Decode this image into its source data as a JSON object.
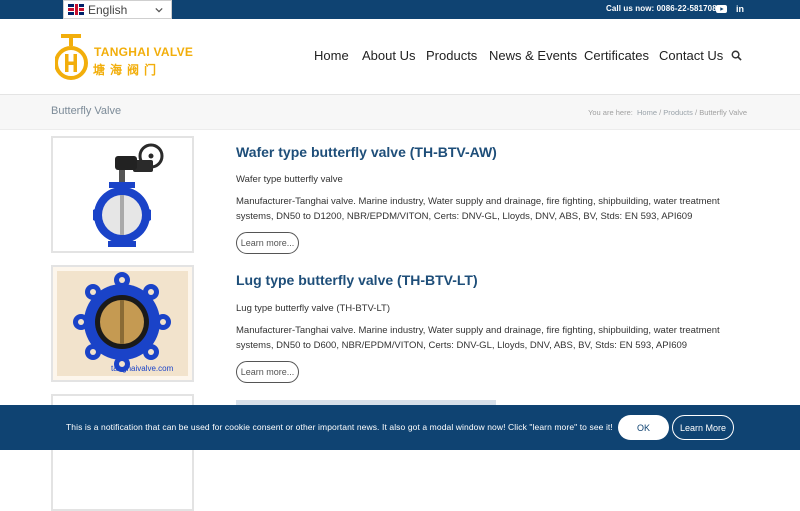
{
  "topbar": {
    "language": "English",
    "call_text": "Call us now: 0086-22-58170822",
    "social": [
      "youtube-icon",
      "linkedin-icon"
    ]
  },
  "header": {
    "logo_text": "TANGHAI VALVE",
    "logo_cn": "塘海阀门",
    "nav": [
      "Home",
      "About Us",
      "Products",
      "News & Events",
      "Certificates",
      "Contact Us"
    ]
  },
  "titlebar": {
    "title": "Butterfly Valve",
    "breadcrumb_prefix": "You are here:",
    "breadcrumbs": [
      "Home",
      "Products",
      "Butterfly Valve"
    ],
    "separator": "/"
  },
  "products": [
    {
      "title": "Wafer type butterfly valve (TH-BTV-AW)",
      "subtitle": "Wafer type butterfly valve",
      "description": "Manufacturer-Tanghai valve. Marine industry, Water supply and drainage, fire fighting, shipbuilding, water treatment systems, DN50 to D1200, NBR/EPDM/VITON, Certs: DNV-GL, Lloyds, DNV, ABS, BV, Stds: EN 593,  API609",
      "button": "Learn more..."
    },
    {
      "title": "Lug type butterfly valve (TH-BTV-LT)",
      "subtitle": "Lug type butterfly valve (TH-BTV-LT)",
      "description": "Manufacturer-Tanghai valve. Marine industry, Water supply and drainage, fire fighting, shipbuilding, water treatment systems, DN50 to D600, NBR/EPDM/VITON, Certs: DNV-GL, Lloyds, DNV, ABS, BV, Stds: EN 593,  API609",
      "button": "Learn more...",
      "image_caption": "tanghaivalve.com"
    }
  ],
  "cookie": {
    "text": "This is a notification that can be used for cookie consent or other important news. It also got a modal window now! Click \"learn more\" to see it!",
    "ok": "OK",
    "learn_more": "Learn More"
  },
  "colors": {
    "primary": "#0f4372",
    "accent": "#f2ae0b",
    "title": "#1e4e79",
    "valve_blue": "#1a43c8"
  }
}
